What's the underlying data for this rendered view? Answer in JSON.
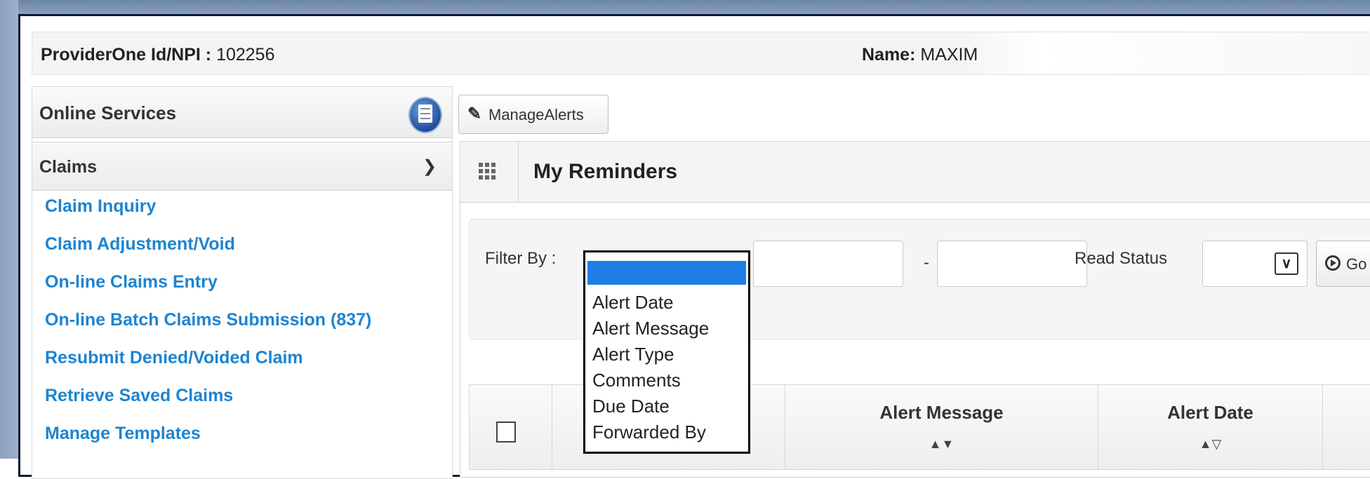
{
  "header": {
    "provider_label": "ProviderOne Id/NPI :",
    "provider_value": "102256",
    "name_label": "Name:",
    "name_value": "MAXIM"
  },
  "sidebar": {
    "section_title": "Online Services",
    "group_title": "Claims",
    "links": [
      "Claim Inquiry",
      "Claim Adjustment/Void",
      "On-line Claims Entry",
      "On-line Batch Claims Submission (837)",
      "Resubmit Denied/Voided Claim",
      "Retrieve Saved Claims",
      "Manage Templates"
    ]
  },
  "toolbar": {
    "manage_alerts_label": "ManageAlerts"
  },
  "reminders": {
    "title": "My Reminders",
    "filter_label": "Filter By :",
    "range_separator": "-",
    "read_status_label": "Read Status",
    "go_label": "Go",
    "filter_options": [
      "Alert Date",
      "Alert Message",
      "Alert Type",
      "Comments",
      "Due Date",
      "Forwarded By"
    ]
  },
  "table": {
    "columns": [
      {
        "label": "Alert Message",
        "sort": "▲▼"
      },
      {
        "label": "Alert Date",
        "sort": "▲▽"
      }
    ],
    "hidden_col_sort": "▲▼"
  }
}
